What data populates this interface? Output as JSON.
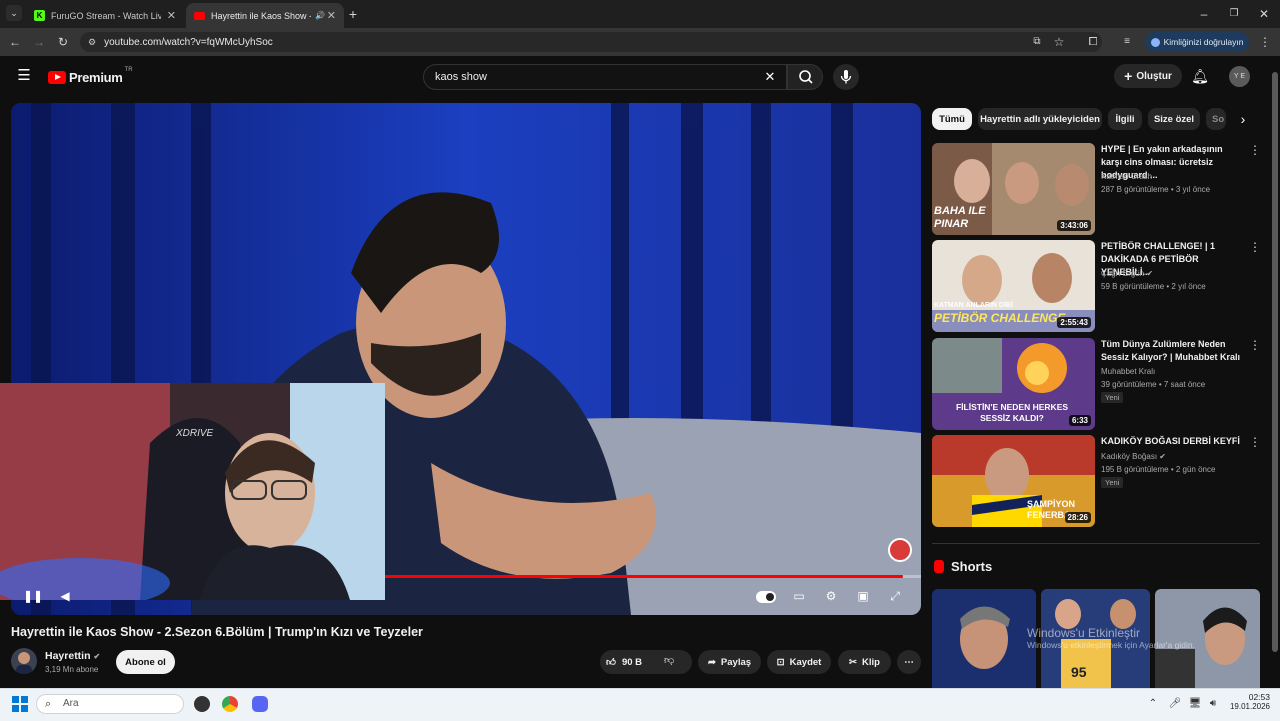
{
  "browser": {
    "tabs": [
      {
        "title": "FuruGO Stream - Watch Live or...",
        "active": false
      },
      {
        "title": "Hayrettin ile Kaos Show - 2...",
        "active": true
      }
    ],
    "url": "youtube.com/watch?v=fqWMcUyhSoc",
    "verify_label": "Kimliğinizi doğrulayın"
  },
  "youtube": {
    "logo_text": "Premium",
    "logo_region": "TR",
    "search_value": "kaos show",
    "create_label": "Oluştur",
    "avatar_initials": "Y E"
  },
  "video": {
    "title": "Hayrettin ile Kaos Show - 2.Sezon 6.Bölüm | Trump'ın Kızı ve Teyzeler",
    "channel": "Hayrettin",
    "subscribers": "3,19 Mn abone",
    "subscribe_label": "Abone ol",
    "likes": "90 B",
    "share_label": "Paylaş",
    "save_label": "Kaydet",
    "clip_label": "Klip",
    "progress": 0.98
  },
  "chips": [
    "Tümü",
    "Hayrettin adlı yükleyiciden",
    "İlgili",
    "Size özel",
    "So"
  ],
  "recommendations": [
    {
      "title": "HYPE | En yakın arkadaşının karşı cins olması: ücretsiz bodyguard ...",
      "channel": "Katman Crash",
      "meta": "287 B görüntüleme • 3 yıl önce",
      "duration": "3:43:06",
      "thumb_text": "BAHA ILE PINAR",
      "verified": false,
      "new": false
    },
    {
      "title": "PETİBÖR CHALLENGE! | 1 DAKİKADA 6 PETİBÖR YENEBİLİ...",
      "channel": "Çağrı Ergün",
      "meta": "59 B görüntüleme • 2 yıl önce",
      "duration": "2:55:43",
      "thumb_text": "PETİBÖR CHALLENGE",
      "thumb_subtext": "KATMAN ANLARIN DİBİ",
      "verified": true,
      "new": false
    },
    {
      "title": "Tüm Dünya Zulümlere Neden Sessiz Kalıyor? | Muhabbet Kralı",
      "channel": "Muhabbet Kralı",
      "meta": "39 görüntüleme • 7 saat önce",
      "duration": "6:33",
      "thumb_text": "FİLİSTİN'E NEDEN HERKES SESSİZ KALDI?",
      "verified": false,
      "new": true
    },
    {
      "title": "KADIKÖY BOĞASI DERBİ KEYFİ",
      "channel": "Kadıköy Boğası",
      "meta": "195 B görüntüleme • 2 gün önce",
      "duration": "28:26",
      "thumb_text": "ŞAMPİYON FENERBA",
      "verified": true,
      "new": true
    }
  ],
  "new_badge": "Yeni",
  "shorts_label": "Shorts",
  "windows_watermark": {
    "line1": "Windows'u Etkinleştir",
    "line2": "Windows'u etkinleştirmek için Ayarlar'a gidin."
  },
  "taskbar": {
    "search_placeholder": "Ara",
    "time": "02:53",
    "date": "19.01.2026"
  },
  "colors": {
    "youtube_red": "#ff0000",
    "accent_blue": "#3ea6ff"
  }
}
